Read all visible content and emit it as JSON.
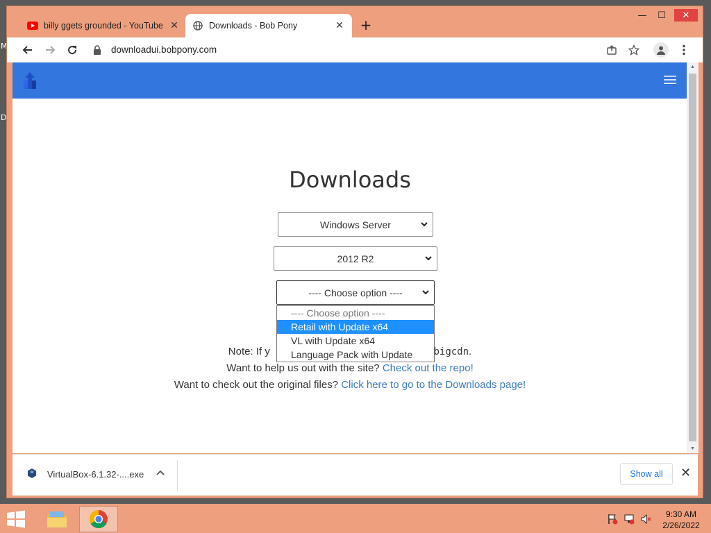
{
  "desktop": {
    "letters": [
      "M",
      "D"
    ]
  },
  "browser": {
    "window_controls": {
      "minimize": "—",
      "maximize": "☐",
      "close": "✕"
    },
    "tabs": [
      {
        "title": "billy ggets grounded - YouTube",
        "favicon": "youtube-icon",
        "active": false
      },
      {
        "title": "Downloads - Bob Pony",
        "favicon": "globe-icon",
        "active": true
      }
    ],
    "new_tab": "+",
    "url": "downloadui.bobpony.com"
  },
  "page": {
    "heading": "Downloads",
    "selects": [
      {
        "value": "Windows Server"
      },
      {
        "value": "2012 R2"
      },
      {
        "value": "---- Choose option ----"
      }
    ],
    "dropdown_options": [
      "---- Choose option ----",
      "Retail with Update x64",
      "VL with Update x64",
      "Language Pack with Update"
    ],
    "dropdown_selected_index": 1,
    "note": {
      "prefix": "Note: If y",
      "suffix": "y ",
      "code": "bigcdn",
      "end": "."
    },
    "help": {
      "text": "Want to help us out with the site? ",
      "link": "Check out the repo!"
    },
    "original": {
      "text": "Want to check out the original files? ",
      "link": "Click here to go to the Downloads page!"
    }
  },
  "downloads_shelf": {
    "file_name": "VirtualBox-6.1.32-....exe",
    "show_all": "Show all"
  },
  "taskbar": {
    "time": "9:30 AM",
    "date": "2/26/2022"
  },
  "colors": {
    "window_frame": "#ee9f7e",
    "navbar": "#3376dd",
    "link": "#3b7bc3",
    "dropdown_highlight": "#1e90ff"
  }
}
